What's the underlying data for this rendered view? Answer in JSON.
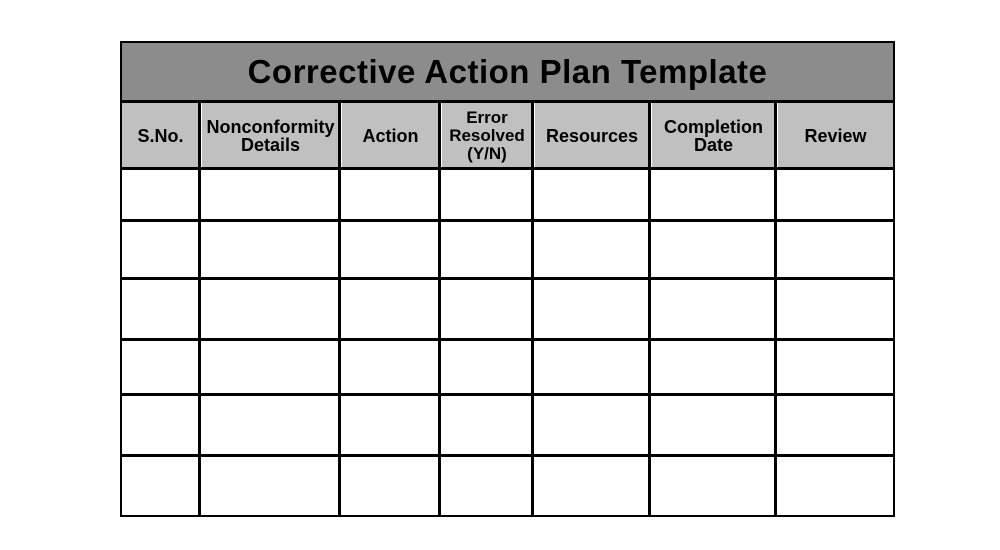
{
  "document": {
    "title": "Corrective Action Plan Template",
    "colors": {
      "title_bg": "#8c8c8c",
      "header_bg": "#c0c0c0",
      "border": "#000000",
      "cell_bg": "#ffffff"
    },
    "columns": [
      {
        "key": "sno",
        "label": "S.No."
      },
      {
        "key": "nonconformity",
        "label": "Nonconformity Details"
      },
      {
        "key": "action",
        "label": "Action"
      },
      {
        "key": "error_resolved",
        "label": "Error Resolved (Y/N)"
      },
      {
        "key": "resources",
        "label": "Resources"
      },
      {
        "key": "completion_date",
        "label": "Completion Date"
      },
      {
        "key": "review",
        "label": "Review"
      }
    ],
    "rows": [
      [
        "",
        "",
        "",
        "",
        "",
        "",
        ""
      ],
      [
        "",
        "",
        "",
        "",
        "",
        "",
        ""
      ],
      [
        "",
        "",
        "",
        "",
        "",
        "",
        ""
      ],
      [
        "",
        "",
        "",
        "",
        "",
        "",
        ""
      ],
      [
        "",
        "",
        "",
        "",
        "",
        "",
        ""
      ],
      [
        "",
        "",
        "",
        "",
        "",
        "",
        ""
      ]
    ]
  }
}
